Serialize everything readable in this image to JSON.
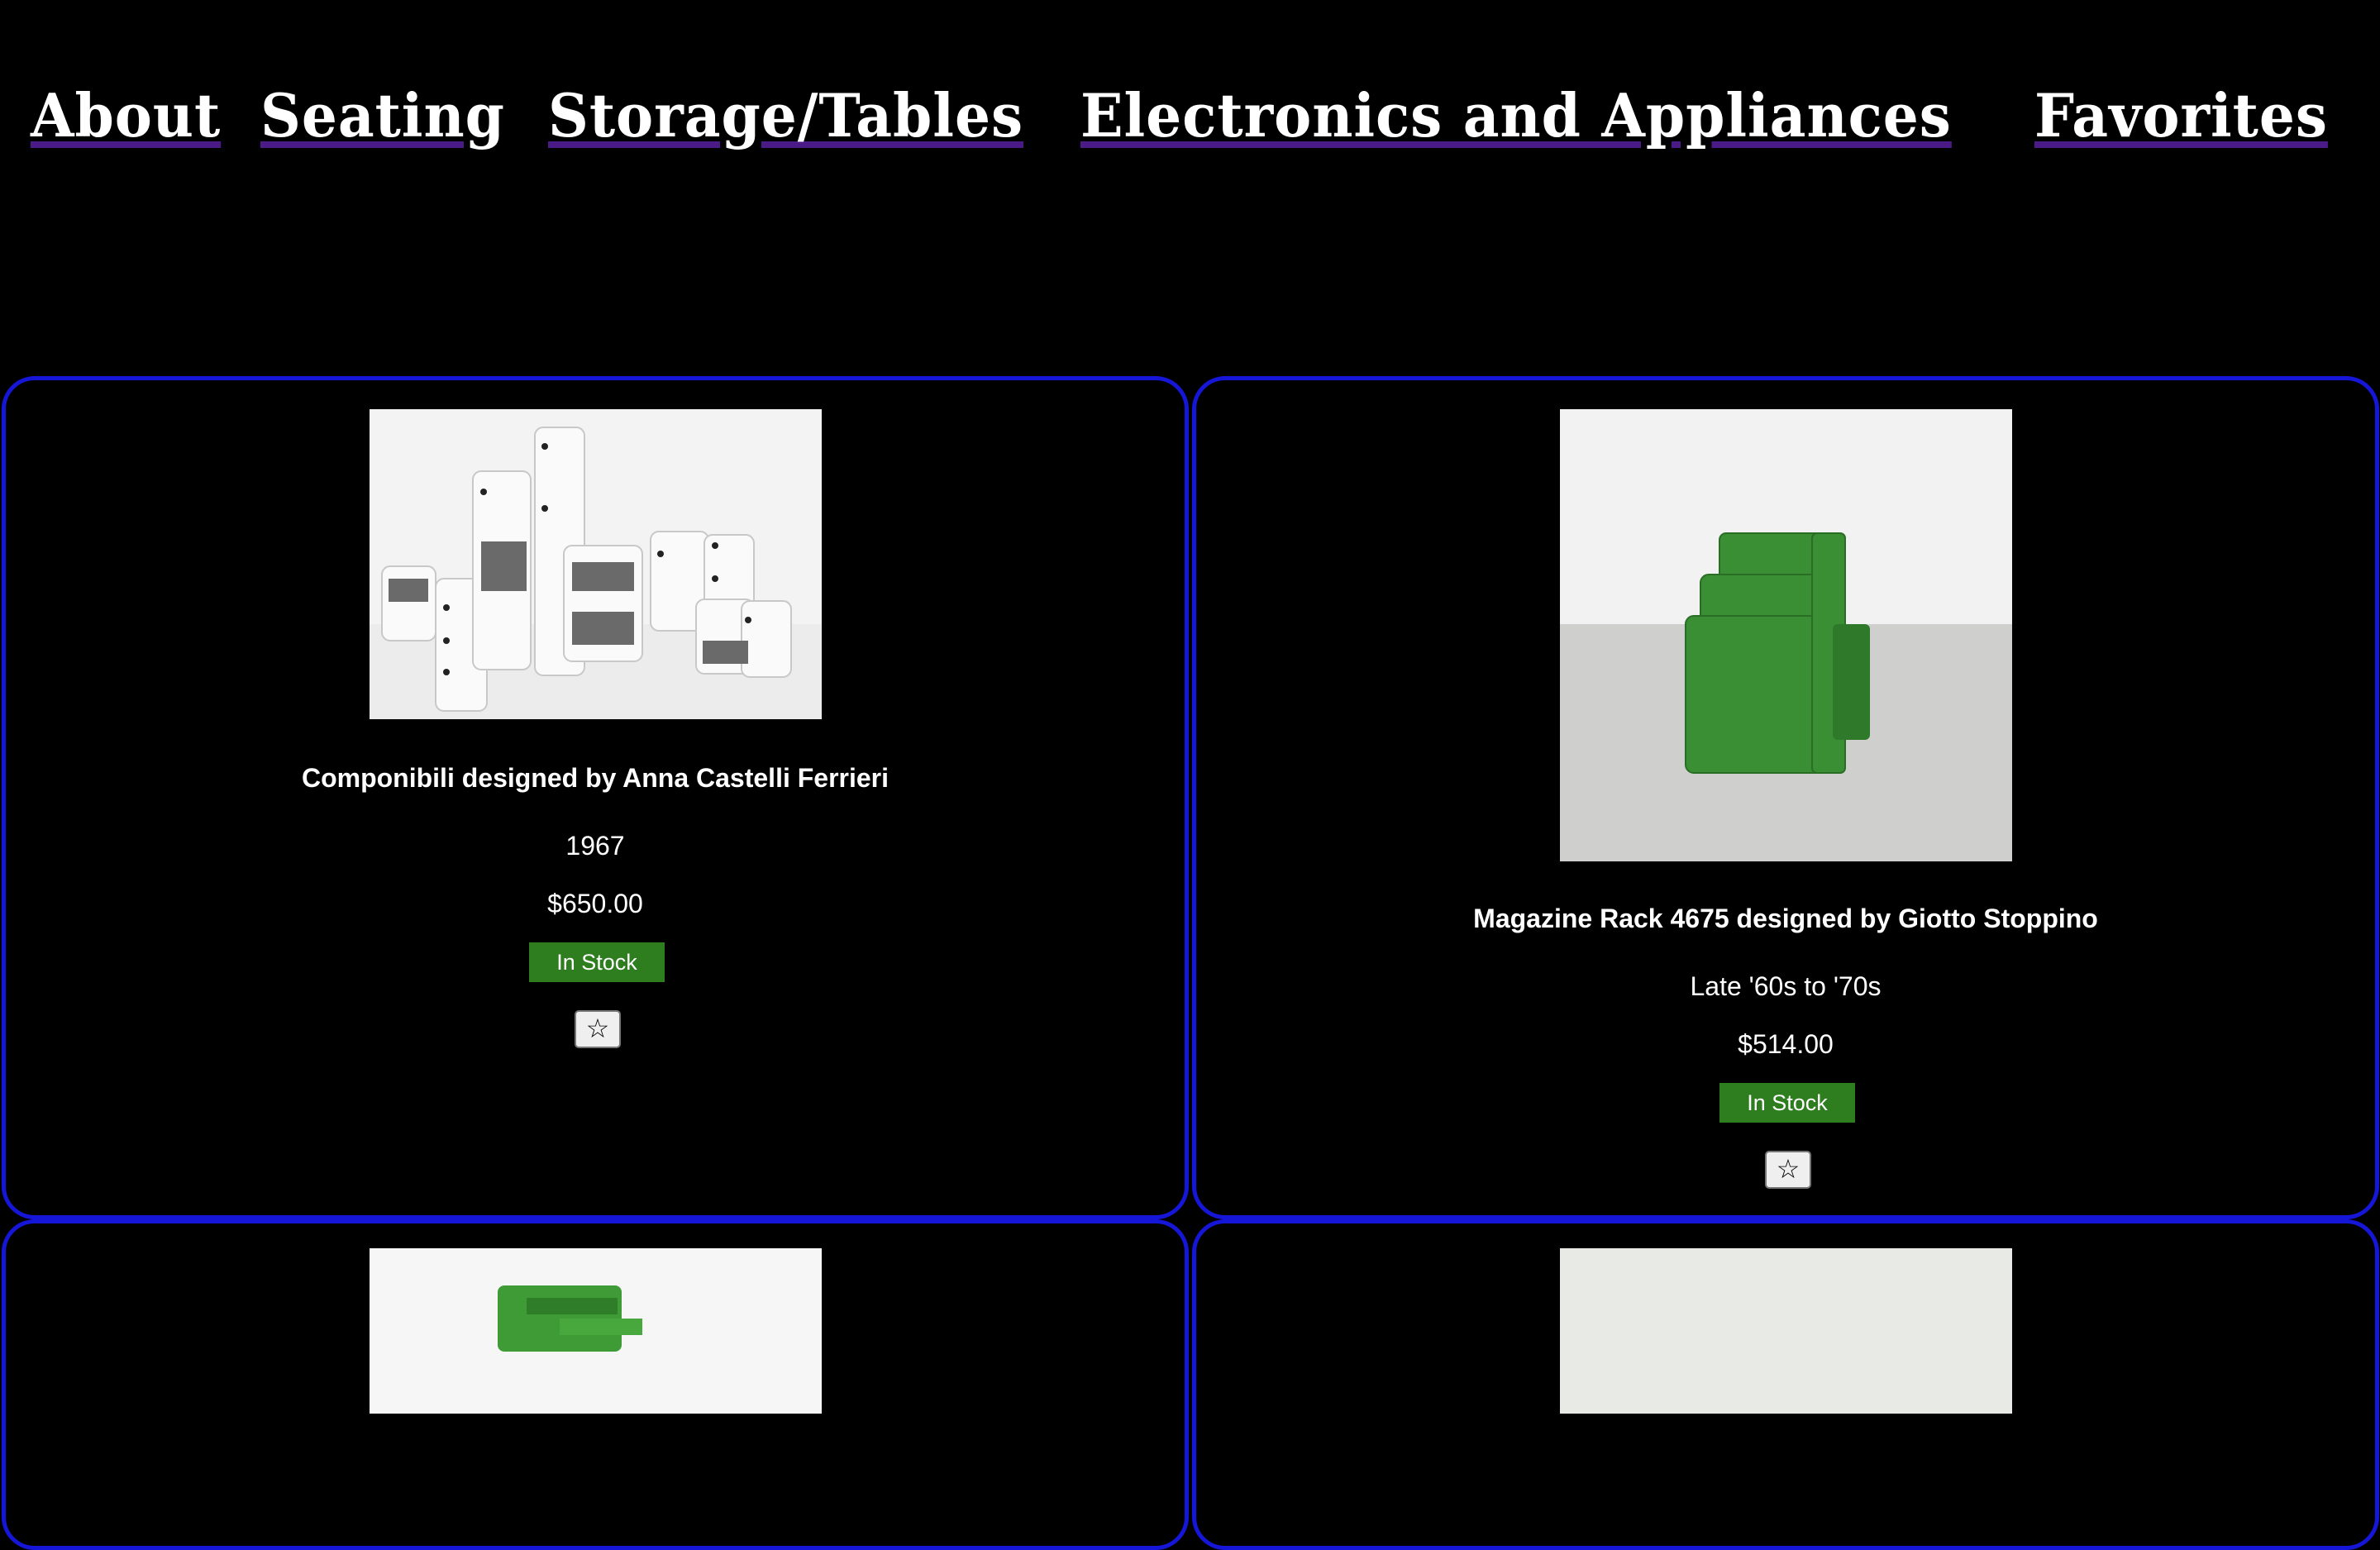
{
  "nav": {
    "items": [
      "About",
      "Seating",
      "Storage/Tables",
      "Electronics and Appliances",
      "Favorites"
    ]
  },
  "products": [
    {
      "title": "Componibili designed by Anna Castelli Ferrieri",
      "year": "1967",
      "price": "$650.00",
      "stock": "In Stock",
      "favorite_icon": "☆"
    },
    {
      "title": "Magazine Rack 4675 designed by Giotto Stoppino",
      "year": "Late '60s to '70s",
      "price": "$514.00",
      "stock": "In Stock",
      "favorite_icon": "☆"
    }
  ],
  "colors": {
    "background": "#000000",
    "card_border": "#1616d8",
    "nav_underline": "#4a1a86",
    "stock_badge": "#2e7d1e"
  }
}
